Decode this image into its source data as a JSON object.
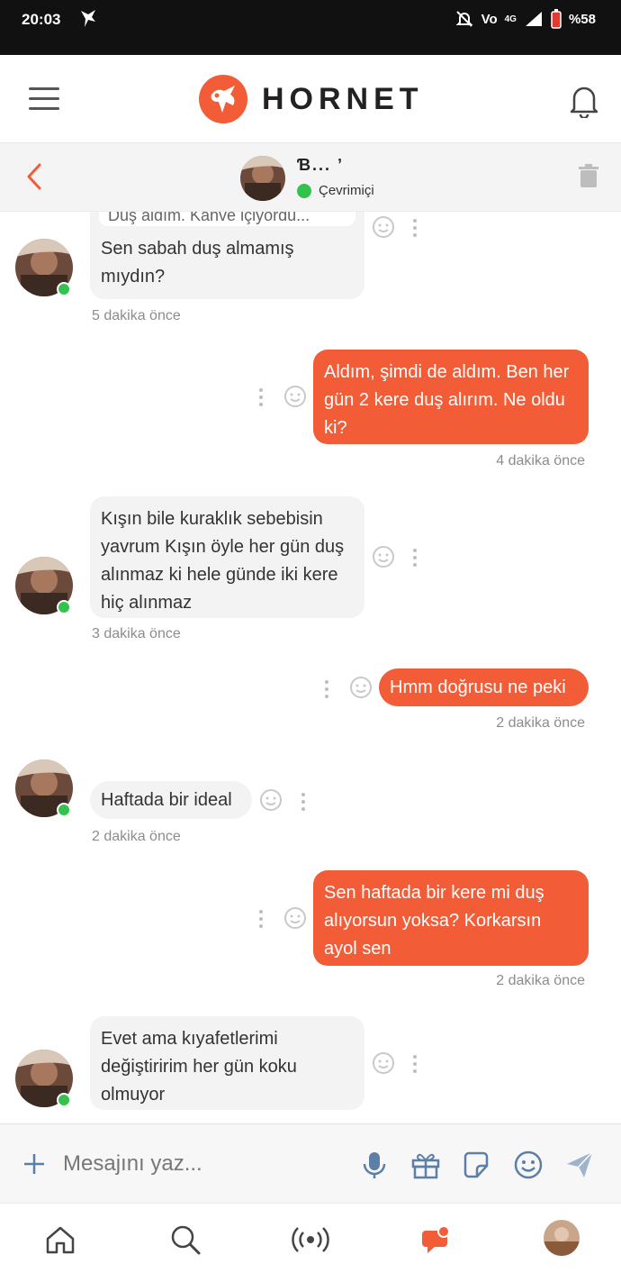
{
  "status_bar": {
    "time": "20:03",
    "battery": "%58",
    "network": "4G"
  },
  "header": {
    "brand": "HORNET"
  },
  "chat_header": {
    "name": "Ɓ... ʼ",
    "status": "Çevrimiçi"
  },
  "messages": [
    {
      "dir": "in",
      "quote": "Duş aldım. Kahve içiyordu...",
      "text": "Sen sabah duş almamış mıydın?",
      "time": "5 dakika önce"
    },
    {
      "dir": "out",
      "text": "Aldım, şimdi de aldım. Ben her gün 2 kere duş alırım. Ne oldu ki?",
      "time": "4 dakika önce"
    },
    {
      "dir": "in",
      "text": "Kışın bile kuraklık sebebisin yavrum Kışın öyle her gün duş alınmaz ki hele günde iki kere hiç alınmaz",
      "time": "3 dakika önce"
    },
    {
      "dir": "out",
      "text": "Hmm doğrusu ne peki",
      "time": "2 dakika önce"
    },
    {
      "dir": "in",
      "text": "Haftada bir ideal",
      "time": "2 dakika önce"
    },
    {
      "dir": "out",
      "text": "Sen haftada bir kere mi duş alıyorsun yoksa? Korkarsın ayol sen",
      "time": "2 dakika önce"
    },
    {
      "dir": "in",
      "text": "Evet ama kıyafetlerimi değiştiririm her gün koku olmuyor",
      "time": ""
    }
  ],
  "input": {
    "placeholder": "Mesajını yaz..."
  },
  "colors": {
    "accent": "#f25c36",
    "online": "#33c24d",
    "incoming_bg": "#f3f3f3"
  },
  "icons": [
    "menu-icon",
    "hornet-logo",
    "bell-icon",
    "back-arrow-icon",
    "trash-icon",
    "emoji-icon",
    "more-icon",
    "plus-icon",
    "microphone-icon",
    "gift-icon",
    "sticker-icon",
    "send-icon",
    "home-icon",
    "search-icon",
    "live-icon",
    "chat-icon",
    "profile-avatar"
  ]
}
